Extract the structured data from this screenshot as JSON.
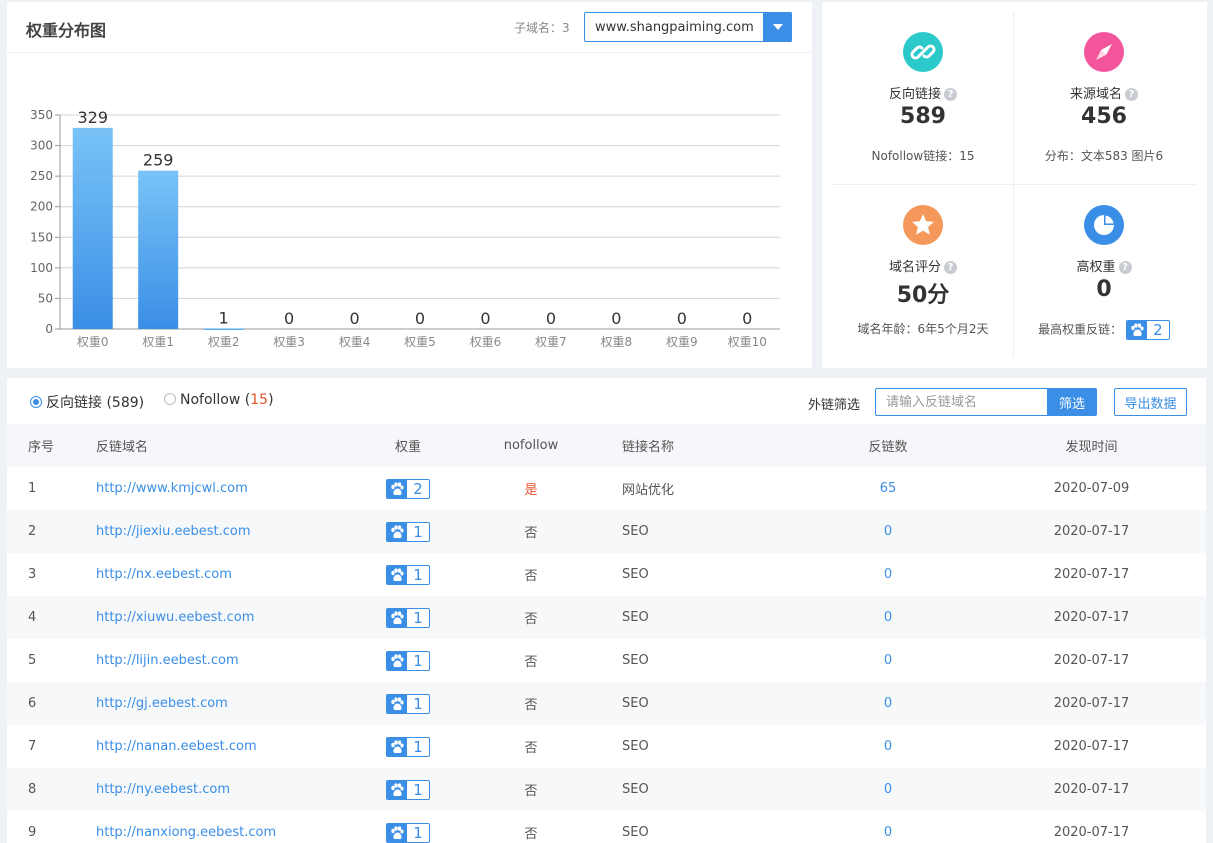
{
  "chart_panel": {
    "title": "权重分布图",
    "subdomain_label": "子域名：3",
    "subdomain_value": "www.shangpaiming.com"
  },
  "chart_data": {
    "type": "bar",
    "categories": [
      "权重0",
      "权重1",
      "权重2",
      "权重3",
      "权重4",
      "权重5",
      "权重6",
      "权重7",
      "权重8",
      "权重9",
      "权重10"
    ],
    "values": [
      329,
      259,
      1,
      0,
      0,
      0,
      0,
      0,
      0,
      0,
      0
    ],
    "yticks": [
      0,
      50,
      100,
      150,
      200,
      250,
      300,
      350
    ],
    "ylim": [
      0,
      350
    ],
    "grid": true,
    "bar_color_top": "#79c3f7",
    "bar_color_bottom": "#3a8ee6"
  },
  "stats": {
    "backlinks": {
      "label": "反向链接",
      "help": "?",
      "value": "589",
      "sub": "Nofollow链接：15",
      "icon": "link-icon",
      "color": "#2bc9c9"
    },
    "domains": {
      "label": "来源域名",
      "help": "?",
      "value": "456",
      "sub": "分布：文本583 图片6",
      "icon": "compass-icon",
      "color": "#f2559b"
    },
    "rating": {
      "label": "域名评分",
      "help": "?",
      "value": "50分",
      "sub": "域名年龄：6年5个月2天",
      "icon": "star-icon",
      "color": "#f5985c"
    },
    "high_weight": {
      "label": "高权重",
      "help": "?",
      "value": "0",
      "sub": "最高权重反链：",
      "sub_badge": "2",
      "icon": "pie-chart-icon",
      "color": "#3a8ee6"
    }
  },
  "filter": {
    "radio_backlinks": "反向链接 (589)",
    "radio_nofollow_prefix": "Nofollow (",
    "radio_nofollow_count": "15",
    "radio_nofollow_suffix": ")",
    "label": "外链筛选",
    "placeholder": "请输入反链域名",
    "button": "筛选",
    "export": "导出数据"
  },
  "table": {
    "headers": {
      "idx": "序号",
      "domain": "反链域名",
      "weight": "权重",
      "nofollow": "nofollow",
      "anchor": "链接名称",
      "links": "反链数",
      "date": "发现时间"
    },
    "rows": [
      {
        "idx": "1",
        "domain": "http://www.kmjcwl.com",
        "weight": "2",
        "nofollow": "是",
        "anchor": "网站优化",
        "links": "65",
        "date": "2020-07-09"
      },
      {
        "idx": "2",
        "domain": "http://jiexiu.eebest.com",
        "weight": "1",
        "nofollow": "否",
        "anchor": "SEO",
        "links": "0",
        "date": "2020-07-17"
      },
      {
        "idx": "3",
        "domain": "http://nx.eebest.com",
        "weight": "1",
        "nofollow": "否",
        "anchor": "SEO",
        "links": "0",
        "date": "2020-07-17"
      },
      {
        "idx": "4",
        "domain": "http://xiuwu.eebest.com",
        "weight": "1",
        "nofollow": "否",
        "anchor": "SEO",
        "links": "0",
        "date": "2020-07-17"
      },
      {
        "idx": "5",
        "domain": "http://lijin.eebest.com",
        "weight": "1",
        "nofollow": "否",
        "anchor": "SEO",
        "links": "0",
        "date": "2020-07-17"
      },
      {
        "idx": "6",
        "domain": "http://gj.eebest.com",
        "weight": "1",
        "nofollow": "否",
        "anchor": "SEO",
        "links": "0",
        "date": "2020-07-17"
      },
      {
        "idx": "7",
        "domain": "http://nanan.eebest.com",
        "weight": "1",
        "nofollow": "否",
        "anchor": "SEO",
        "links": "0",
        "date": "2020-07-17"
      },
      {
        "idx": "8",
        "domain": "http://ny.eebest.com",
        "weight": "1",
        "nofollow": "否",
        "anchor": "SEO",
        "links": "0",
        "date": "2020-07-17"
      },
      {
        "idx": "9",
        "domain": "http://nanxiong.eebest.com",
        "weight": "1",
        "nofollow": "否",
        "anchor": "SEO",
        "links": "0",
        "date": "2020-07-17"
      }
    ]
  }
}
